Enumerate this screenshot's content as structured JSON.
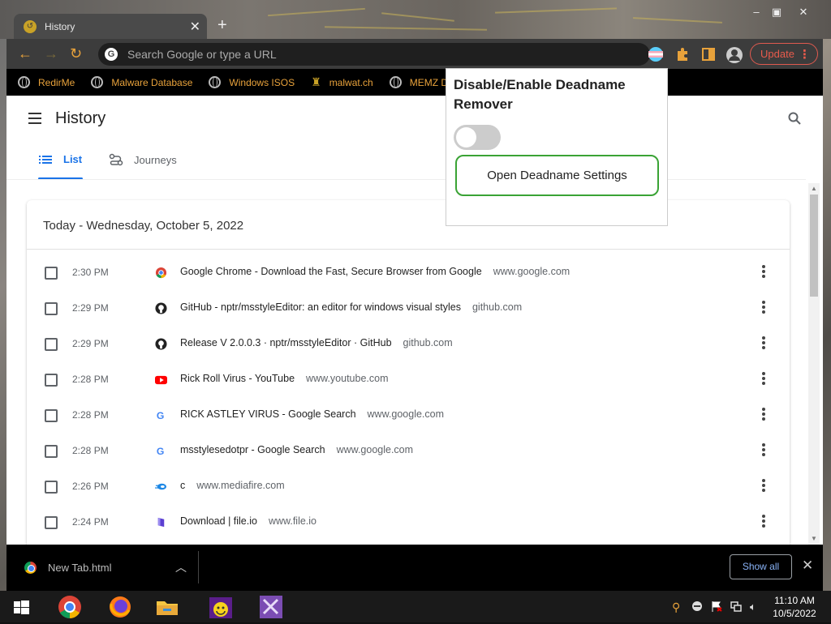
{
  "browser": {
    "tab_title": "History",
    "omnibox_placeholder": "Search Google or type a URL",
    "update_label": "Update"
  },
  "bookmarks": [
    {
      "label": "RedirMe"
    },
    {
      "label": "Malware Database"
    },
    {
      "label": "Windows ISOS"
    },
    {
      "label": "malwat.ch"
    },
    {
      "label": "MEMZ Down"
    }
  ],
  "history": {
    "page_title": "History",
    "tabs": {
      "list": "List",
      "journeys": "Journeys"
    },
    "day_header": "Today - Wednesday, October 5, 2022",
    "rows": [
      {
        "time": "2:30 PM",
        "title": "Google Chrome - Download the Fast, Secure Browser from Google",
        "domain": "www.google.com",
        "icon": "chrome-icon"
      },
      {
        "time": "2:29 PM",
        "title": "GitHub - nptr/msstyleEditor: an editor for windows visual styles",
        "domain": "github.com",
        "icon": "github-icon"
      },
      {
        "time": "2:29 PM",
        "title": "Release V 2.0.0.3 · nptr/msstyleEditor · GitHub",
        "domain": "github.com",
        "icon": "github-icon"
      },
      {
        "time": "2:28 PM",
        "title": "Rick Roll Virus - YouTube",
        "domain": "www.youtube.com",
        "icon": "youtube-icon"
      },
      {
        "time": "2:28 PM",
        "title": "RICK ASTLEY VIRUS - Google Search",
        "domain": "www.google.com",
        "icon": "google-icon"
      },
      {
        "time": "2:28 PM",
        "title": "msstylesedotpr - Google Search",
        "domain": "www.google.com",
        "icon": "google-icon"
      },
      {
        "time": "2:26 PM",
        "title": "c",
        "domain": "www.mediafire.com",
        "icon": "mediafire-icon"
      },
      {
        "time": "2:24 PM",
        "title": "Download | file.io",
        "domain": "www.file.io",
        "icon": "fileio-icon"
      }
    ]
  },
  "popup": {
    "title": "Disable/Enable Deadname Remover",
    "toggle_on": false,
    "button_label": "Open Deadname Settings"
  },
  "download_bar": {
    "file_name": "New Tab.html",
    "show_all_label": "Show all"
  },
  "taskbar": {
    "time": "11:10 AM",
    "date": "10/5/2022"
  },
  "colors": {
    "accent": "#1a73e8",
    "bookmark_text": "#e8a23b",
    "update": "#e85b4c",
    "popup_button_border": "#3aa335"
  }
}
